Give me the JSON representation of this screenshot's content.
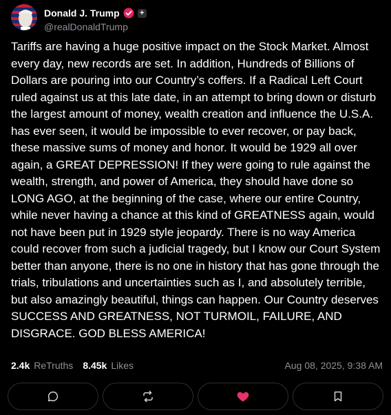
{
  "author": {
    "display_name": "Donald J. Trump",
    "handle": "@realDonaldTrump",
    "verified_badge_color": "#e0245e"
  },
  "post": {
    "text": "Tariffs are having a huge positive impact on the Stock Market. Almost every day, new records are set. In addition, Hundreds of Billions of Dollars are pouring into our Country’s coffers. If a Radical Left Court ruled against us at this late date, in an attempt to bring down or disturb the largest amount of money, wealth creation and influence the U.S.A. has ever seen, it would be impossible to ever recover, or pay back, these massive sums of money and honor. It would be 1929 all over again, a GREAT DEPRESSION! If they were going to rule against the wealth, strength, and power of America, they should have done so LONG AGO, at the beginning of the case, where our entire Country, while never having a chance at this kind of GREATNESS again, would not have been put in 1929 style jeopardy. There is no way America could recover from such a judicial tragedy, but I know our Court System better than anyone, there is no one in history that has gone through the trials, tribulations and uncertainties such as I, and absolutely terrible, but also amazingly beautiful, things can happen. Our Country deserves SUCCESS AND GREATNESS, NOT TURMOIL, FAILURE, AND DISGRACE. GOD BLESS AMERICA!"
  },
  "stats": {
    "retruths_count": "2.4k",
    "retruths_label": "ReTruths",
    "likes_count": "8.45k",
    "likes_label": "Likes",
    "timestamp": "Aug 08, 2025, 9:38 AM"
  },
  "actions": [
    {
      "icon": "comment-icon"
    },
    {
      "icon": "retruth-icon"
    },
    {
      "icon": "heart-icon",
      "color": "#e8326a"
    },
    {
      "icon": "bookmark-icon"
    }
  ],
  "colors": {
    "background": "#000000",
    "muted_text": "#8f8f99",
    "like_accent": "#e8326a"
  }
}
